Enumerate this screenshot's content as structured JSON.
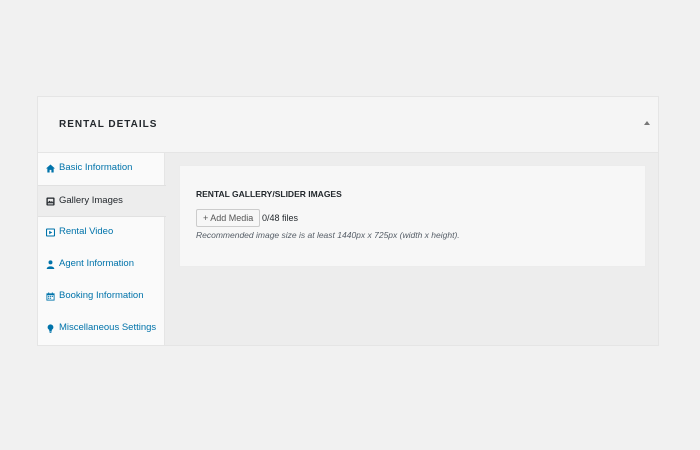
{
  "panel": {
    "title": "RENTAL DETAILS",
    "toggle_icon": "caret-up-icon"
  },
  "tabs": [
    {
      "label": "Basic Information",
      "icon": "home-icon",
      "active": false
    },
    {
      "label": "Gallery Images",
      "icon": "gallery-icon",
      "active": true
    },
    {
      "label": "Rental Video",
      "icon": "video-icon",
      "active": false
    },
    {
      "label": "Agent Information",
      "icon": "user-icon",
      "active": false
    },
    {
      "label": "Booking Information",
      "icon": "calendar-icon",
      "active": false
    },
    {
      "label": "Miscellaneous Settings",
      "icon": "lightbulb-icon",
      "active": false
    }
  ],
  "gallery": {
    "title": "RENTAL GALLERY/SLIDER IMAGES",
    "add_media_label": "+ Add Media",
    "file_count": "0/48 files",
    "hint": "Recommended image size is at least 1440px x 725px (width x height)."
  },
  "colors": {
    "link": "#0073aa",
    "text": "#23282d",
    "page_background": "#f1f1f1"
  }
}
